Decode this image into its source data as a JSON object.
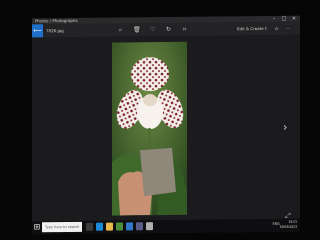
{
  "window": {
    "title": "Photos / Photographs"
  },
  "toolbar": {
    "file_name": "7826.jpg",
    "see_all_icon": "back-arrow-icon",
    "actions": [
      "zoom-icon",
      "delete-icon",
      "favorite-icon",
      "rotate-icon",
      "crop-icon"
    ],
    "right_items": [
      "Edit & Create",
      "Share",
      "Print",
      "More"
    ]
  },
  "viewer": {
    "image_subject": "",
    "next_icon": "chevron-right-icon"
  },
  "taskbar": {
    "search_placeholder": "Type here to search",
    "apps": [
      "task-view",
      "edge",
      "file-explorer",
      "store",
      "mail",
      "photos",
      "app"
    ],
    "tray": "ENG",
    "time": "19:21",
    "date": "03/03/2023"
  }
}
